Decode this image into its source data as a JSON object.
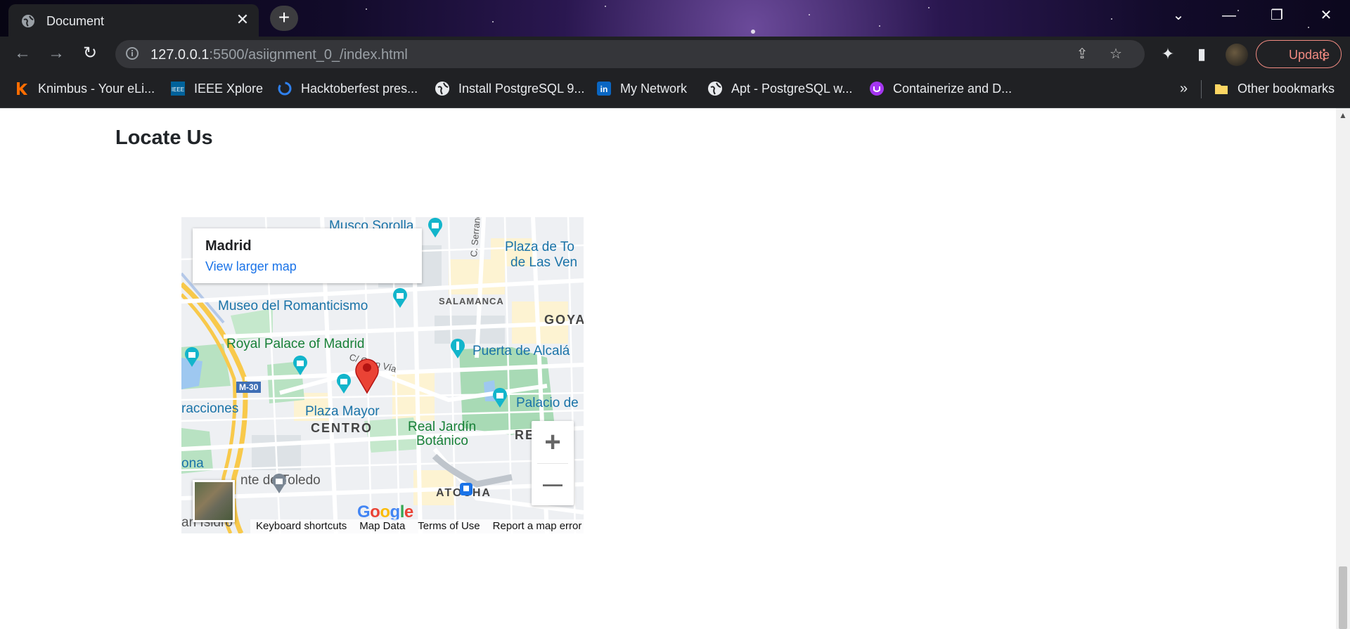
{
  "browser": {
    "tab_title": "Document",
    "url_host": "127.0.0.1",
    "url_rest": ":5500/asiignment_0_/index.html",
    "update_label": "Update",
    "bookmarks": [
      {
        "label": "Knimbus - Your eLi...",
        "icon": "knimbus-icon",
        "color": "#ff6d00"
      },
      {
        "label": "IEEE Xplore",
        "icon": "ieee-icon",
        "color": "#00629b"
      },
      {
        "label": "Hacktoberfest pres...",
        "icon": "hacktoberfest-icon",
        "color": "#2f80ed"
      },
      {
        "label": "Install PostgreSQL 9...",
        "icon": "globe-icon",
        "color": "#e8eaed"
      },
      {
        "label": "My Network",
        "icon": "linkedin-icon",
        "color": "#0a66c2"
      },
      {
        "label": "Apt - PostgreSQL w...",
        "icon": "globe-icon",
        "color": "#e8eaed"
      },
      {
        "label": "Containerize and D...",
        "icon": "udemy-icon",
        "color": "#a435f0"
      }
    ],
    "more_bookmarks": "»",
    "other_bookmarks": "Other bookmarks"
  },
  "page": {
    "section_title": "Locate Us"
  },
  "map": {
    "place_name": "Madrid",
    "view_larger": "View larger map",
    "zoom_in": "+",
    "zoom_out": "—",
    "google": "Google",
    "attributions": [
      "Keyboard shortcuts",
      "Map Data",
      "Terms of Use",
      "Report a map error"
    ],
    "labels": {
      "musco_sorolla": "Musco Sorolla",
      "plaza_toros": "Plaza de To",
      "de_las_ven": "de Las Ven",
      "c_serrano": "C. Serrano",
      "salamanca": "SALAMANCA",
      "museo_romanticismo": "Museo del Romanticismo",
      "goya": "GOYA",
      "royal_palace": "Royal Palace of Madrid",
      "puerta_alcala": "Puerta de Alcalá",
      "gran_via": "C/ Gran Vía",
      "m30": "M-30",
      "palacio": "Palacio de",
      "racciones": "racciones",
      "plaza_mayor": "Plaza Mayor",
      "centro": "CENTRO",
      "real_jardin_1": "Real Jardín",
      "real_jardin_2": "Botánico",
      "re": "RE",
      "ona": "ona",
      "nte_toledo": "nte de Toledo",
      "atocha": "ATOCHA",
      "an_isidro": "an Isidro"
    }
  }
}
